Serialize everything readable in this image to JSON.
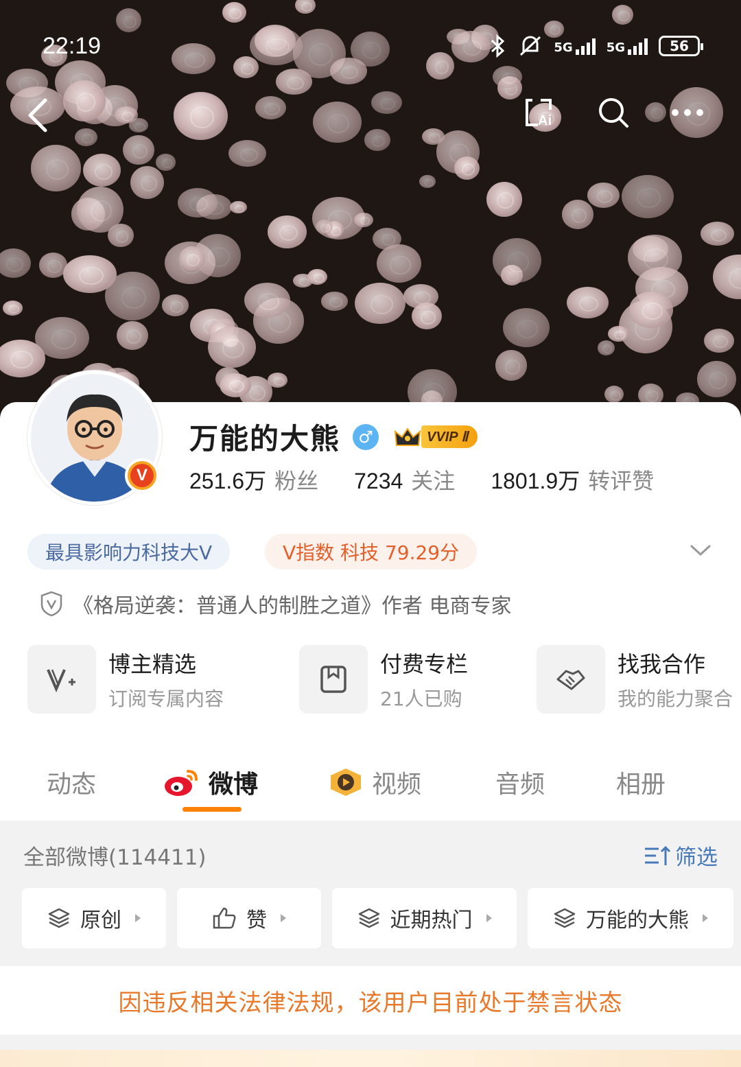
{
  "status_bar": {
    "time": "22:19",
    "network_1": "5G",
    "network_2": "5G",
    "battery": "56"
  },
  "nav": {
    "back_icon": "chevron-left-icon",
    "ai_icon": "ai-scan-icon",
    "search_icon": "search-icon",
    "more_icon": "more-icon"
  },
  "profile": {
    "name": "万能的大熊",
    "gender_symbol": "♂",
    "vvip_label": "VVIP Ⅱ",
    "verified_badge": "V",
    "stats": [
      {
        "value": "251.6万",
        "label": "粉丝"
      },
      {
        "value": "7234",
        "label": "关注"
      },
      {
        "value": "1801.9万",
        "label": "转评赞"
      }
    ],
    "tags": {
      "influence": "最具影响力科技大V",
      "v_index": "V指数 科技 79.29分"
    },
    "bio": "《格局逆袭：普通人的制胜之道》作者 电商专家"
  },
  "features": [
    {
      "title": "博主精选",
      "subtitle": "订阅专属内容"
    },
    {
      "title": "付费专栏",
      "subtitle": "21人已购"
    },
    {
      "title": "找我合作",
      "subtitle": "我的能力聚合"
    }
  ],
  "tabs": [
    {
      "label": "动态"
    },
    {
      "label": "微博"
    },
    {
      "label": "视频"
    },
    {
      "label": "音频"
    },
    {
      "label": "相册"
    }
  ],
  "feed": {
    "header": "全部微博(114411)",
    "filter_label": "筛选",
    "chips": [
      "原创",
      "赞",
      "近期热门",
      "万能的大熊"
    ],
    "notice": "因违反相关法律法规，该用户目前处于禁言状态"
  },
  "colors": {
    "accent_orange": "#ff8200",
    "notice_orange": "#e8792a",
    "link_blue": "#4779b8"
  }
}
